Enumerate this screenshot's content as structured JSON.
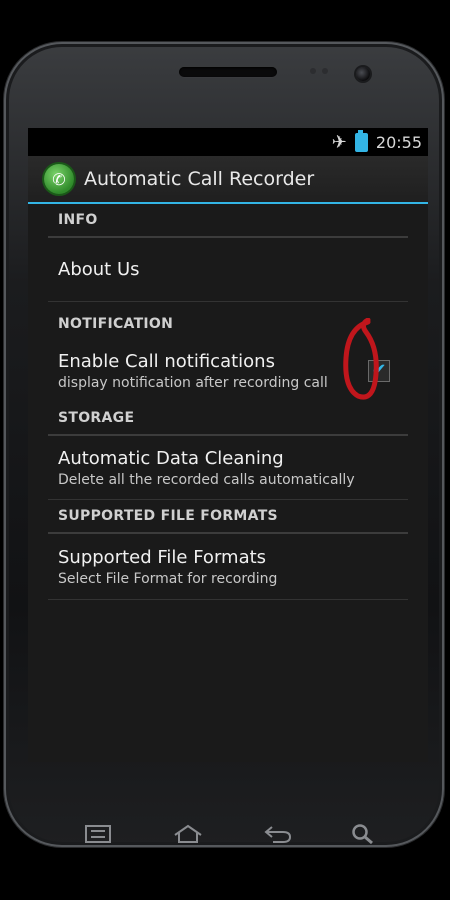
{
  "status_bar": {
    "time": "20:55",
    "icons": [
      "airplane-mode-icon",
      "battery-icon"
    ]
  },
  "action_bar": {
    "app_icon": "phone-icon",
    "title": "Automatic Call Recorder"
  },
  "preferences": {
    "info": {
      "header": "INFO",
      "about_title": "About Us"
    },
    "notification": {
      "header": "NOTIFICATION",
      "title": "Enable Call notifications",
      "summary": "display notification after recording call",
      "checked": true
    },
    "storage": {
      "header": "STORAGE",
      "title": "Automatic Data Cleaning",
      "summary": "Delete all the recorded calls automatically"
    },
    "formats": {
      "header": "SUPPORTED FILE FORMATS",
      "title": "Supported File Formats",
      "summary": "Select File Format for recording"
    }
  },
  "nav_bar": {
    "buttons": [
      "menu-icon",
      "home-icon",
      "back-icon",
      "search-icon"
    ]
  },
  "colors": {
    "accent": "#33b5e5",
    "annotation": "#c0161c"
  }
}
